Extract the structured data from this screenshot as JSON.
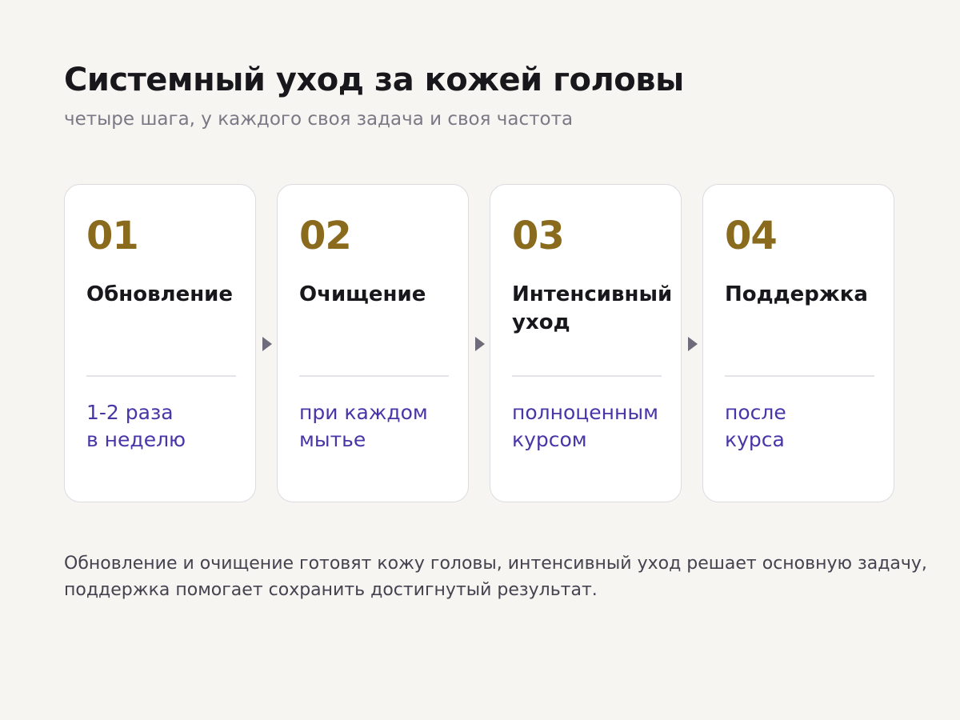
{
  "header": {
    "title": "Системный уход за кожей головы",
    "subtitle": "четыре шага, у каждого своя задача и своя частота"
  },
  "steps": [
    {
      "number": "01",
      "title": "Обновление",
      "frequency": "1-2 раза\nв неделю"
    },
    {
      "number": "02",
      "title": "Очищение",
      "frequency": "при каждом\nмытье"
    },
    {
      "number": "03",
      "title": "Интенсивный уход",
      "frequency": "полноценным\nкурсом"
    },
    {
      "number": "04",
      "title": "Поддержка",
      "frequency": "после\nкурса"
    }
  ],
  "footer": {
    "note": "Обновление и очищение готовят кожу головы, интенсивный уход решает основную задачу, поддержка помогает сохранить достигнутый результат."
  },
  "colors": {
    "background": "#f6f5f2",
    "number_accent": "#8a6a1c",
    "frequency_accent": "#4a35a8",
    "arrow": "#6e6b7a"
  },
  "icons": {
    "connector": "arrow-right-icon"
  }
}
